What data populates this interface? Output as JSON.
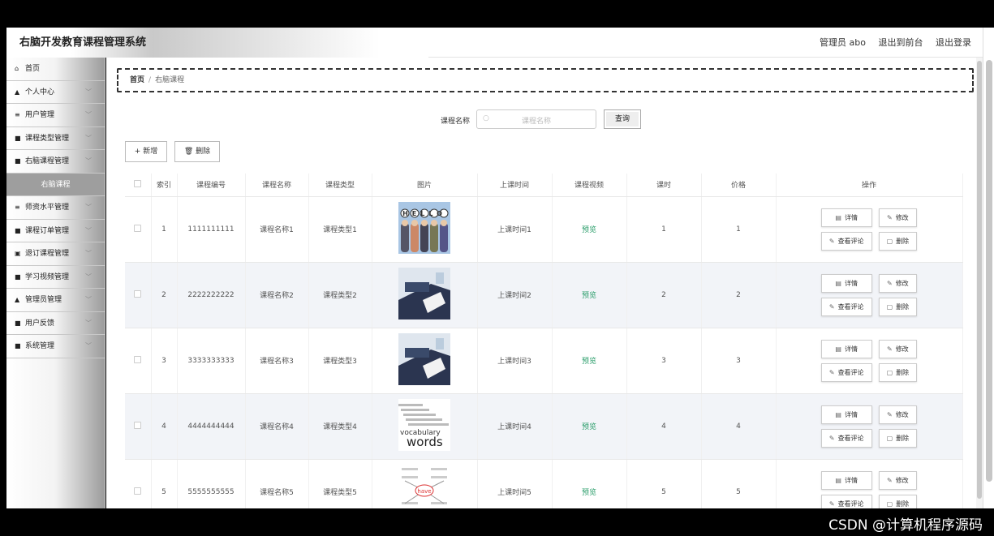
{
  "header": {
    "title": "右脑开发教育课程管理系统",
    "admin": "管理员 abo",
    "exit_front": "退出到前台",
    "logout": "退出登录"
  },
  "sidebar": {
    "items": [
      {
        "icon": "home-icon",
        "glyph": "⌂",
        "label": "首页",
        "arrow": false
      },
      {
        "icon": "user-icon",
        "glyph": "▲",
        "label": "个人中心",
        "arrow": true
      },
      {
        "icon": "list-icon",
        "glyph": "≡",
        "label": "用户管理",
        "arrow": true
      },
      {
        "icon": "grid-icon",
        "glyph": "■",
        "label": "课程类型管理",
        "arrow": true
      },
      {
        "icon": "grid-icon",
        "glyph": "■",
        "label": "右脑课程管理",
        "arrow": true
      },
      {
        "icon": "",
        "glyph": "",
        "label": "右脑课程",
        "arrow": false,
        "sub": true
      },
      {
        "icon": "sliders-icon",
        "glyph": "≡",
        "label": "师资水平管理",
        "arrow": true
      },
      {
        "icon": "grid-icon",
        "glyph": "■",
        "label": "课程订单管理",
        "arrow": true
      },
      {
        "icon": "file-icon",
        "glyph": "▣",
        "label": "退订课程管理",
        "arrow": true
      },
      {
        "icon": "grid-icon",
        "glyph": "■",
        "label": "学习视频管理",
        "arrow": true
      },
      {
        "icon": "admin-icon",
        "glyph": "▲",
        "label": "管理员管理",
        "arrow": true
      },
      {
        "icon": "grid-icon",
        "glyph": "■",
        "label": "用户反馈",
        "arrow": true
      },
      {
        "icon": "grid-icon",
        "glyph": "■",
        "label": "系统管理",
        "arrow": true
      }
    ]
  },
  "breadcrumb": {
    "home": "首页",
    "sep": "/",
    "current": "右脑课程"
  },
  "search": {
    "label": "课程名称",
    "placeholder": "课程名称",
    "button": "查询"
  },
  "toolbar": {
    "add": "+ 新增",
    "delete": "删除"
  },
  "table": {
    "headers": [
      "索引",
      "课程编号",
      "课程名称",
      "课程类型",
      "图片",
      "上课时间",
      "课程视频",
      "课时",
      "价格",
      "操作"
    ],
    "rows": [
      {
        "index": "1",
        "code": "1111111111",
        "name": "课程名称1",
        "type": "课程类型1",
        "time": "上课时间1",
        "video": "预览",
        "hours": "1",
        "price": "1"
      },
      {
        "index": "2",
        "code": "2222222222",
        "name": "课程名称2",
        "type": "课程类型2",
        "time": "上课时间2",
        "video": "预览",
        "hours": "2",
        "price": "2"
      },
      {
        "index": "3",
        "code": "3333333333",
        "name": "课程名称3",
        "type": "课程类型3",
        "time": "上课时间3",
        "video": "预览",
        "hours": "3",
        "price": "3"
      },
      {
        "index": "4",
        "code": "4444444444",
        "name": "课程名称4",
        "type": "课程类型4",
        "time": "上课时间4",
        "video": "预览",
        "hours": "4",
        "price": "4"
      },
      {
        "index": "5",
        "code": "5555555555",
        "name": "课程名称5",
        "type": "课程类型5",
        "time": "上课时间5",
        "video": "预览",
        "hours": "5",
        "price": "5"
      }
    ],
    "ops": {
      "detail": "详情",
      "edit": "修改",
      "comments": "查看评论",
      "delete": "删除"
    }
  },
  "thumb_text": {
    "hello": "HELLO",
    "vocab": "vocabulary",
    "words": "words",
    "have": "have"
  },
  "watermark": "CSDN @计算机程序源码"
}
